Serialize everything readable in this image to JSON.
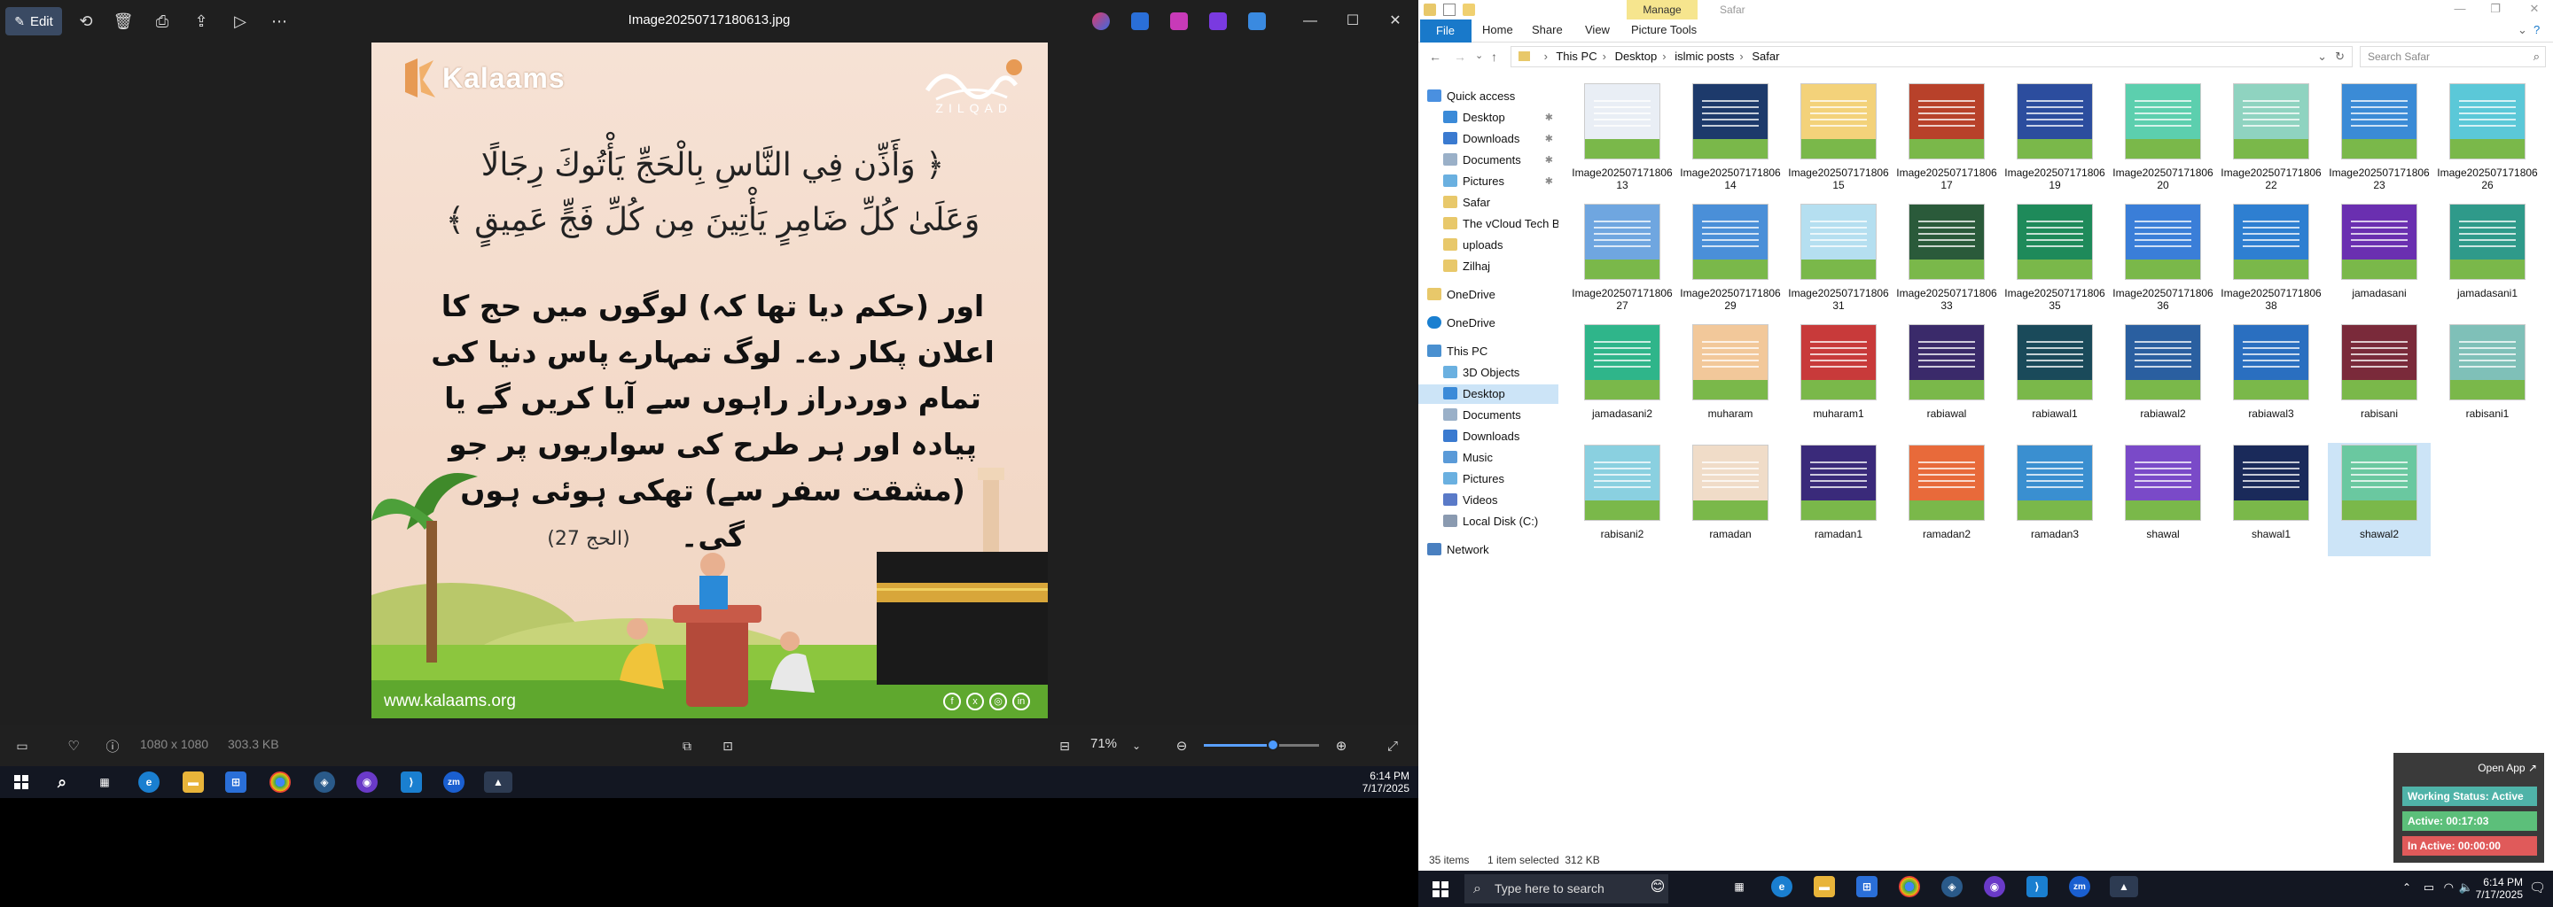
{
  "photos": {
    "edit_label": "Edit",
    "title": "Image20250717180613.jpg",
    "info_dimensions": "1080 x 1080",
    "info_size": "303.3 KB",
    "zoom": "71%",
    "zoom_fraction": 0.6,
    "poster": {
      "logo": "Kalaams",
      "hijri_label": "ZILQAD",
      "arabic": "﴿ وَأَذِّن فِي النَّاسِ بِالْحَجِّ يَأْتُوكَ رِجَالًا وَعَلَىٰ كُلِّ ضَامِرٍ يَأْتِينَ مِن كُلِّ فَجٍّ عَمِيقٍ ﴾",
      "urdu": "اور (حکم دیا تھا کہ) لوگوں میں حج کا اعلان پکار دے۔ لوگ تمہارے پاس دنیا کی تمام دوردراز راہوں سے آیا کریں گے یا پیادہ اور ہر طرح کی سواریوں پر جو (مشقت سفر سے) تھکی ہوئی ہوں گی۔",
      "reference": "(الحج 27)",
      "website": "www.kalaams.org"
    }
  },
  "taskbar_left": {
    "time": "6:14 PM",
    "date": "7/17/2025"
  },
  "explorer": {
    "manage_tab": "Manage",
    "window_title": "Safar",
    "ribbon": {
      "file": "File",
      "home": "Home",
      "share": "Share",
      "view": "View",
      "picture_tools": "Picture Tools"
    },
    "breadcrumb": [
      "This PC",
      "Desktop",
      "islmic posts",
      "Safar"
    ],
    "search_placeholder": "Search Safar",
    "nav": {
      "quick_access": "Quick access",
      "desktop": "Desktop",
      "downloads": "Downloads",
      "documents": "Documents",
      "pictures": "Pictures",
      "safar": "Safar",
      "vcloud": "The vCloud Tech Blo",
      "uploads": "uploads",
      "zilhaj": "Zilhaj",
      "onedrive1": "OneDrive",
      "onedrive2": "OneDrive",
      "this_pc": "This PC",
      "objects3d": "3D Objects",
      "pc_desktop": "Desktop",
      "pc_documents": "Documents",
      "pc_downloads": "Downloads",
      "music": "Music",
      "pc_pictures": "Pictures",
      "videos": "Videos",
      "local_disk": "Local Disk (C:)",
      "network": "Network"
    },
    "files": [
      "Image20250717180613",
      "Image20250717180614",
      "Image20250717180615",
      "Image20250717180617",
      "Image20250717180619",
      "Image20250717180620",
      "Image20250717180622",
      "Image20250717180623",
      "Image20250717180626",
      "Image20250717180627",
      "Image20250717180629",
      "Image20250717180631",
      "Image20250717180633",
      "Image20250717180635",
      "Image20250717180636",
      "Image20250717180638",
      "jamadasani",
      "jamadasani1",
      "jamadasani2",
      "muharam",
      "muharam1",
      "rabiawal",
      "rabiawal1",
      "rabiawal2",
      "rabiawal3",
      "rabisani",
      "rabisani1",
      "rabisani2",
      "ramadan",
      "ramadan1",
      "ramadan2",
      "ramadan3",
      "shawal",
      "shawal1",
      "shawal2"
    ],
    "thumb_colors": [
      "#e9eef5",
      "#1d3a6b",
      "#f3d27a",
      "#b8412a",
      "#2c4d9e",
      "#5ccfae",
      "#8fd3c0",
      "#3b8bd6",
      "#5bc8d8",
      "#6fa6e0",
      "#4a8fd8",
      "#b5dff0",
      "#2a5a3a",
      "#1e8a5a",
      "#3a7ed8",
      "#2e7fd1",
      "#6a2fb0",
      "#2f9a8a",
      "#2fb58a",
      "#f2c89a",
      "#c83a3a",
      "#3a2a6a",
      "#1a4a5a",
      "#2a5fa0",
      "#2a6fc0",
      "#7a2a3a",
      "#7fc0b8",
      "#8ad0e0",
      "#f0dcc8",
      "#3a2a7a",
      "#e86a3a",
      "#3a8fd0",
      "#7a4ac8",
      "#1a2a5a",
      "#6ac8a0"
    ],
    "status_items": "35 items",
    "status_selected": "1 item selected  312 KB"
  },
  "widget": {
    "open_app": "Open App",
    "working_status": "Working Status: Active",
    "active": "Active: 00:17:03",
    "in_active": "In Active: 00:00:00"
  },
  "taskbar_right": {
    "search_placeholder": "Type here to search",
    "time": "6:14 PM",
    "date": "7/17/2025"
  },
  "colors": {
    "accent": "#1979ca",
    "selection": "#cce4f7",
    "widget_green": "#5cbf7a",
    "widget_red": "#e05a5a",
    "widget_teal": "#4fb3a8"
  }
}
